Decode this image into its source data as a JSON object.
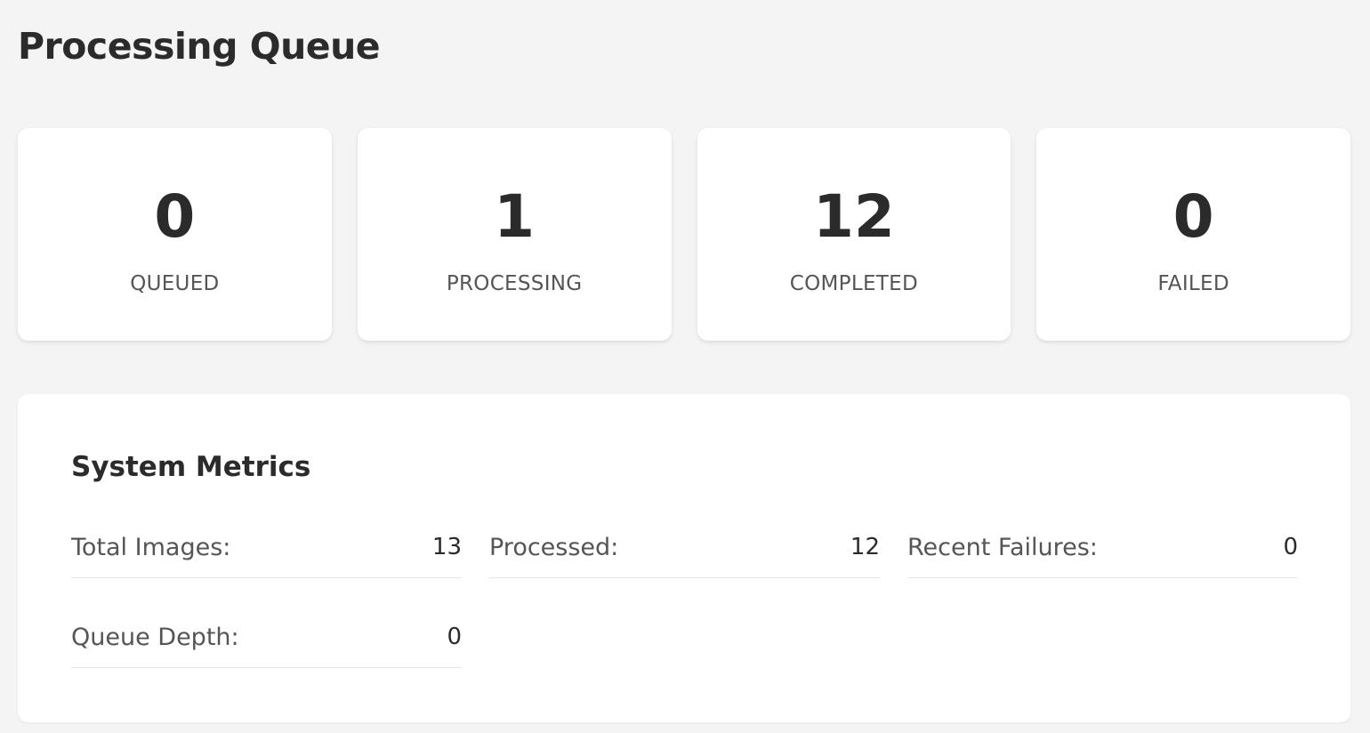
{
  "page": {
    "title": "Processing Queue"
  },
  "stats": [
    {
      "value": "0",
      "label": "QUEUED"
    },
    {
      "value": "1",
      "label": "PROCESSING"
    },
    {
      "value": "12",
      "label": "COMPLETED"
    },
    {
      "value": "0",
      "label": "FAILED"
    }
  ],
  "metrics": {
    "title": "System Metrics",
    "items": [
      {
        "label": "Total Images:",
        "value": "13"
      },
      {
        "label": "Processed:",
        "value": "12"
      },
      {
        "label": "Recent Failures:",
        "value": "0"
      },
      {
        "label": "Queue Depth:",
        "value": "0"
      }
    ]
  },
  "colors": {
    "background": "#f4f4f4",
    "card": "#ffffff",
    "text_primary": "#2b2b2b",
    "text_secondary": "#555555"
  }
}
